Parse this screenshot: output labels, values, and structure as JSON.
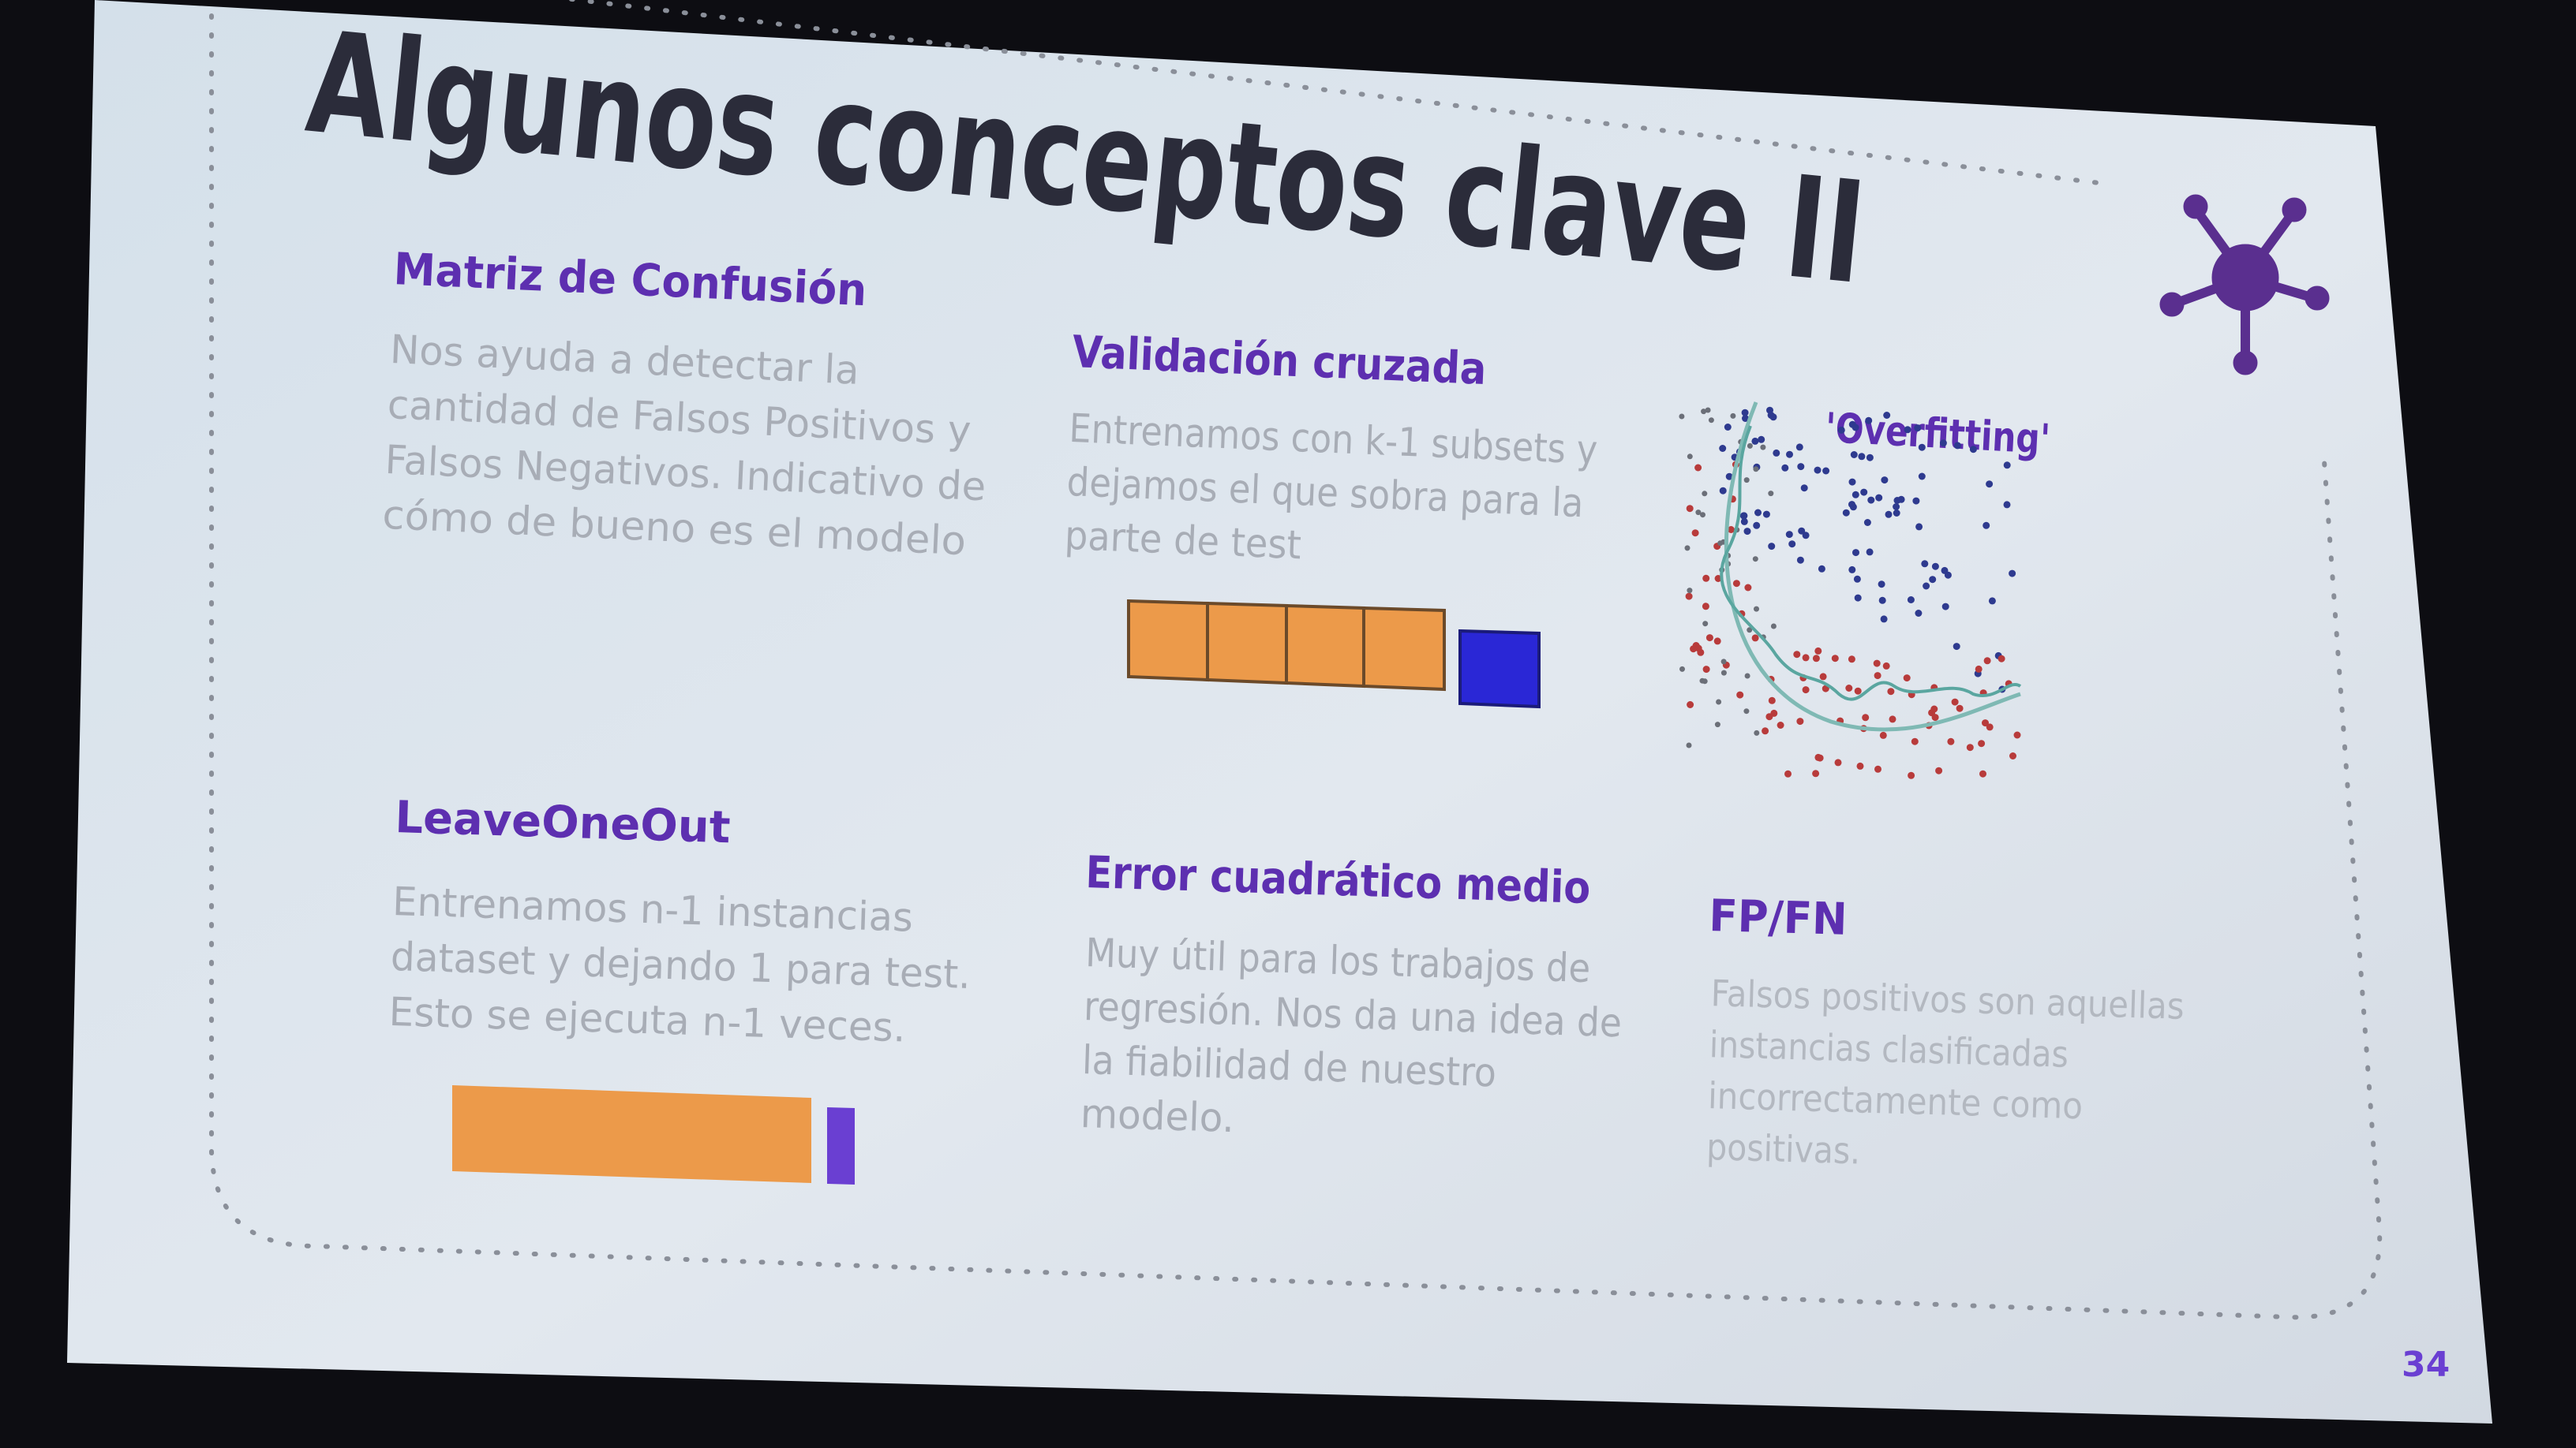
{
  "slide": {
    "title": "Algunos conceptos clave II",
    "page_number": "34",
    "sections": [
      {
        "heading": "Matriz de Confusión",
        "lines": [
          "Nos ayuda a detectar la",
          "cantidad de Falsos Positivos y",
          "Falsos Negativos. Indicativo de",
          "cómo de bueno es el modelo"
        ]
      },
      {
        "heading": "Validación cruzada",
        "lines": [
          "Entrenamos con k-1 subsets y",
          "dejamos el que sobra para la",
          "parte de test"
        ]
      },
      {
        "heading": "LeaveOneOut",
        "lines": [
          "Entrenamos n-1 instancias",
          "dataset y dejando 1 para test.",
          "Esto se ejecuta n-1 veces."
        ]
      },
      {
        "heading": "Error cuadrático medio",
        "lines": [
          "Muy útil para los trabajos de",
          "regresión. Nos da una idea de",
          "la fiabilidad de nuestro",
          "modelo."
        ]
      },
      {
        "heading": "FP/FN",
        "lines": [
          "Falsos positivos son aquellas",
          "instancias clasificadas",
          "incorrectamente como",
          "positivas."
        ]
      }
    ],
    "overfitting_label": "'Overfitting'"
  },
  "colors": {
    "screen_dark": "#0d0d12",
    "slide_bg": "#dfe6ee",
    "title": "#2b2c3a",
    "heading_purple": "#5d2fb0",
    "body_gray": "#a8adb6",
    "orange": "#ec9a4a",
    "blue": "#2a27d6",
    "purple_bar": "#6a3fd2",
    "icon_purple": "#5a2f8f",
    "dot_border": "#8a8f99"
  },
  "icons": [
    "network-hub-icon"
  ]
}
